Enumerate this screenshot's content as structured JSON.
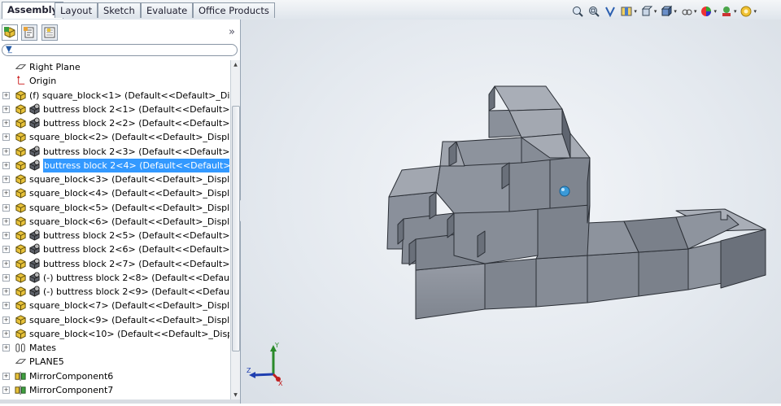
{
  "tabs": [
    {
      "label": "Assembly",
      "active": true
    },
    {
      "label": "Layout",
      "active": false
    },
    {
      "label": "Sketch",
      "active": false
    },
    {
      "label": "Evaluate",
      "active": false
    },
    {
      "label": "Office Products",
      "active": false
    }
  ],
  "view_toolbar": [
    "zoom-to-fit-icon",
    "zoom-to-area-icon",
    "previous-view-icon",
    "section-view-icon",
    "view-orientation-icon",
    "display-style-icon",
    "hide-show-items-icon",
    "edit-appearance-icon",
    "apply-scene-icon",
    "view-settings-icon"
  ],
  "panel": {
    "tabs": [
      "feature-manager-icon",
      "property-manager-icon",
      "configuration-manager-icon"
    ],
    "chevron": "»"
  },
  "tree": [
    {
      "label": "Right Plane",
      "icon": "plane-icon",
      "expandable": false
    },
    {
      "label": "Origin",
      "icon": "origin-icon",
      "expandable": false
    },
    {
      "label": "(f) square_block<1> (Default<<Default>_Display",
      "icon": "part-icon",
      "expandable": true
    },
    {
      "label": "buttress block 2<1> (Default<<Default>_Disp",
      "icon": "part-icon",
      "expandable": true,
      "suppressed_icon": true
    },
    {
      "label": "buttress block 2<2> (Default<<Default>_Disp",
      "icon": "part-icon",
      "expandable": true,
      "suppressed_icon": true
    },
    {
      "label": "square_block<2> (Default<<Default>_Display St",
      "icon": "part-icon",
      "expandable": true
    },
    {
      "label": "buttress block 2<3> (Default<<Default>_Disp",
      "icon": "part-icon",
      "expandable": true,
      "suppressed_icon": true
    },
    {
      "label": "buttress block 2<4> (Default<<Default>_Disp",
      "icon": "part-icon",
      "expandable": true,
      "suppressed_icon": true,
      "selected": true
    },
    {
      "label": "square_block<3> (Default<<Default>_Display St",
      "icon": "part-icon",
      "expandable": true
    },
    {
      "label": "square_block<4> (Default<<Default>_Display St",
      "icon": "part-icon",
      "expandable": true
    },
    {
      "label": "square_block<5> (Default<<Default>_Display St",
      "icon": "part-icon",
      "expandable": true
    },
    {
      "label": "square_block<6> (Default<<Default>_Display St",
      "icon": "part-icon",
      "expandable": true
    },
    {
      "label": "buttress block 2<5> (Default<<Default>_Disp",
      "icon": "part-icon",
      "expandable": true,
      "suppressed_icon": true
    },
    {
      "label": "buttress block 2<6> (Default<<Default>_Disp",
      "icon": "part-icon",
      "expandable": true,
      "suppressed_icon": true
    },
    {
      "label": "buttress block 2<7> (Default<<Default>_Disp",
      "icon": "part-icon",
      "expandable": true,
      "suppressed_icon": true
    },
    {
      "label": "(-) buttress block 2<8> (Default<<Default>_I",
      "icon": "part-icon",
      "expandable": true,
      "suppressed_icon": true
    },
    {
      "label": "(-) buttress block 2<9> (Default<<Default>_I",
      "icon": "part-icon",
      "expandable": true,
      "suppressed_icon": true
    },
    {
      "label": "square_block<7> (Default<<Default>_Display St",
      "icon": "part-icon",
      "expandable": true
    },
    {
      "label": "square_block<9> (Default<<Default>_Display St",
      "icon": "part-icon",
      "expandable": true
    },
    {
      "label": "square_block<10> (Default<<Default>_Display S",
      "icon": "part-icon",
      "expandable": true
    },
    {
      "label": "Mates",
      "icon": "mates-icon",
      "expandable": true
    },
    {
      "label": "PLANE5",
      "icon": "plane-icon",
      "expandable": false
    },
    {
      "label": "MirrorComponent6",
      "icon": "mirror-icon",
      "expandable": true
    },
    {
      "label": "MirrorComponent7",
      "icon": "mirror-icon",
      "expandable": true
    }
  ],
  "triad": {
    "x": "X",
    "y": "Y",
    "z": "Z"
  },
  "colors": {
    "selection": "#3399ff",
    "block_face": "#8a909b",
    "block_top": "#a5aab3",
    "block_side": "#5f6570"
  }
}
